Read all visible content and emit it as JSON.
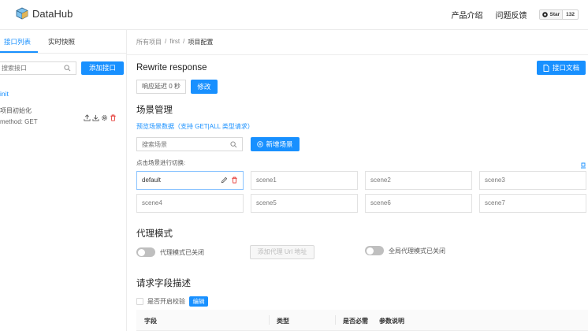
{
  "app": {
    "name": "DataHub"
  },
  "nav": {
    "product": "产品介绍",
    "feedback": "问题反馈",
    "github_star": "Star",
    "github_count": "132"
  },
  "left": {
    "tabs": [
      {
        "label": "接口列表",
        "active": true
      },
      {
        "label": "实时快照",
        "active": false
      }
    ],
    "search_placeholder": "搜索接口",
    "add_button": "添加接口",
    "group": "init",
    "item": {
      "name": "项目初始化",
      "method": "method: GET"
    }
  },
  "breadcrumb": [
    "所有项目",
    "first",
    "项目配置"
  ],
  "main": {
    "title": "Rewrite response",
    "doc_button": "接口文档",
    "delay_label": "响应延迟 0 秒",
    "modify_button": "修改"
  },
  "scenes": {
    "title": "场景管理",
    "preview_link": "预览场景数据（支持 GET|ALL 类型请求）",
    "search_placeholder": "搜索场景",
    "new_button": "新增场景",
    "switch_hint": "点击场景进行切换:",
    "items": [
      "default",
      "scene1",
      "scene2",
      "scene3",
      "scene4",
      "scene5",
      "scene6",
      "scene7"
    ],
    "active": "default"
  },
  "proxy": {
    "title": "代理模式",
    "proxy_off": "代理模式已关闭",
    "add_proxy_url": "添加代理 Url 地址",
    "global_proxy_off": "全局代理模式已关闭"
  },
  "request_fields": {
    "title": "请求字段描述",
    "validate_label": "是否开启校验",
    "edit_button": "编辑",
    "columns": [
      "字段",
      "类型",
      "是否必需",
      "参数说明"
    ]
  },
  "colors": {
    "primary": "#1890ff",
    "border": "#d9d9d9",
    "toggle_off": "#bfbfbf"
  }
}
